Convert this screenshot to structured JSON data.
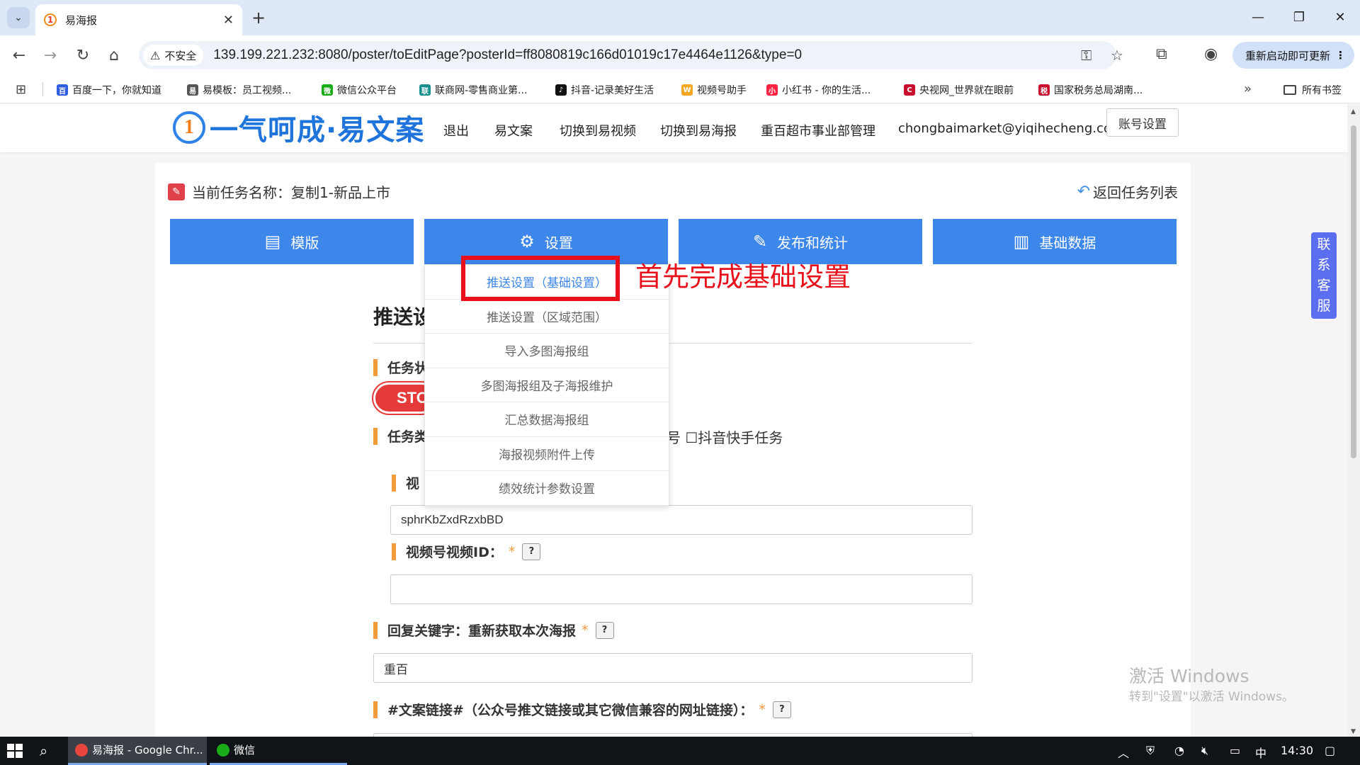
{
  "browser": {
    "tab_title": "易海报",
    "tab_favicon": "1",
    "close_glyph": "✕",
    "new_tab_glyph": "+",
    "security_label": "不安全",
    "url": "139.199.221.232:8080/poster/toEditPage?posterId=ff8080819c166d01019c17e4464e1126&type=0",
    "update_label": "重新启动即可更新",
    "bookmarks": [
      {
        "label": "百度一下，你就知道",
        "color": "#2f5fe0",
        "icon": "百"
      },
      {
        "label": "易模板：员工视频...",
        "color": "#555555",
        "icon": "易"
      },
      {
        "label": "微信公众平台",
        "color": "#1aad19",
        "icon": "微"
      },
      {
        "label": "联商网-零售商业第...",
        "color": "#1a8f8f",
        "icon": "联"
      },
      {
        "label": "抖音-记录美好生活",
        "color": "#111111",
        "icon": "♪"
      },
      {
        "label": "视频号助手",
        "color": "#f5a623",
        "icon": "W"
      },
      {
        "label": "小红书 - 你的生活...",
        "color": "#ff2442",
        "icon": "小"
      },
      {
        "label": "央视网_世界就在眼前",
        "color": "#c8102e",
        "icon": "C"
      },
      {
        "label": "国家税务总局湖南...",
        "color": "#c8102e",
        "icon": "税"
      }
    ],
    "all_bookmarks": "所有书签"
  },
  "site": {
    "logo_text": "一气呵成·易文案",
    "logo_mark": "1",
    "nav": [
      "退出",
      "易文案",
      "切换到易视频",
      "切换到易海报",
      "重百超市事业部管理",
      "chongbaimarket@yiqihecheng.cc"
    ],
    "account_button": "账号设置"
  },
  "page": {
    "task_name": "当前任务名称：复制1-新品上市",
    "back_link": "返回任务列表",
    "tabs": [
      {
        "label": "模版",
        "icon": "template-icon"
      },
      {
        "label": "设置",
        "icon": "gear-icon"
      },
      {
        "label": "发布和统计",
        "icon": "edit-icon"
      },
      {
        "label": "基础数据",
        "icon": "data-icon"
      }
    ],
    "section_title": "推送设置",
    "section_title_visible": "推送设",
    "fields": {
      "task_status_label": "任务状",
      "stop_button": "STOP",
      "task_type_label": "任务类",
      "task_type_options_visible": "号 ☐抖音快手任务",
      "video_label": "视",
      "video_account_value": "sphrKbZxdRzxbBD",
      "video_id_label": "视频号视频ID：",
      "video_id_value": "",
      "keyword_label": "回复关键字：重新获取本次海报",
      "keyword_value": "重百",
      "link_label": "#文案链接#（公众号推文链接或其它微信兼容的网址链接）：",
      "required_mark": "*",
      "help_mark": "?"
    },
    "dropdown": [
      {
        "label": "推送设置（基础设置）",
        "active": true
      },
      {
        "label": "推送设置（区域范围）",
        "active": false
      },
      {
        "label": "导入多图海报组",
        "active": false
      },
      {
        "label": "多图海报组及子海报维护",
        "active": false
      },
      {
        "label": "汇总数据海报组",
        "active": false
      },
      {
        "label": "海报视频附件上传",
        "active": false
      },
      {
        "label": "绩效统计参数设置",
        "active": false
      }
    ],
    "annotation": "首先完成基础设置",
    "customer_service": [
      "联",
      "系",
      "客",
      "服"
    ]
  },
  "watermark": {
    "line1": "激活 Windows",
    "line2": "转到\"设置\"以激活 Windows。"
  },
  "taskbar": {
    "apps": [
      {
        "label": "易海报 - Google Chr...",
        "active": true,
        "color": "#e8453c"
      },
      {
        "label": "微信",
        "active": false,
        "color": "#1aad19"
      }
    ],
    "ime": "中",
    "clock": "14:30"
  }
}
